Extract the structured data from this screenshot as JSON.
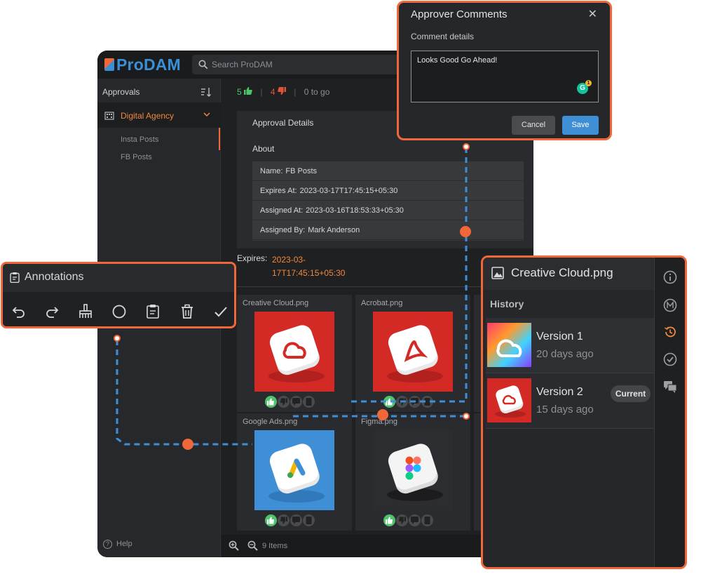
{
  "app": {
    "logo": "ProDAM",
    "search_placeholder": "Search ProDAM"
  },
  "sidebar": {
    "heading": "Approvals",
    "agency": "Digital Agency",
    "items": [
      {
        "label": "Insta Posts"
      },
      {
        "label": "FB Posts"
      }
    ],
    "help": "Help"
  },
  "votes": {
    "up": "5",
    "down": "4",
    "to_go": "0 to go"
  },
  "details": {
    "title": "Approval Details",
    "about": "About",
    "rows": [
      {
        "key": "Name:",
        "value": "FB Posts"
      },
      {
        "key": "Expires At:",
        "value": "2023-03-17T17:45:15+05:30"
      },
      {
        "key": "Assigned At:",
        "value": "2023-03-16T18:53:33+05:30"
      },
      {
        "key": "Assigned By:",
        "value": "Mark Anderson"
      }
    ],
    "expires_label": "Expires:",
    "expires_value": "2023-03-17T17:45:15+05:30"
  },
  "assets": [
    {
      "name": "Creative Cloud.png"
    },
    {
      "name": "Acrobat.png"
    },
    {
      "name": "Google Ads.png"
    },
    {
      "name": "Figma.png"
    }
  ],
  "footer": {
    "count": "9 Items"
  },
  "modal": {
    "title": "Approver Comments",
    "subtitle": "Comment details",
    "comment": "Looks Good Go Ahead!",
    "cancel": "Cancel",
    "save": "Save"
  },
  "annotations": {
    "title": "Annotations",
    "tools": [
      "undo-icon",
      "redo-icon",
      "brush-icon",
      "circle-icon",
      "note-icon",
      "trash-icon",
      "check-icon"
    ]
  },
  "panel": {
    "title": "Creative Cloud.png",
    "history": "History",
    "versions": [
      {
        "name": "Version 1",
        "age": "20 days ago"
      },
      {
        "name": "Version 2",
        "age": "15 days ago",
        "badge": "Current"
      }
    ]
  },
  "colors": {
    "accent": "#f0683a",
    "approve": "#4fc36b",
    "reject": "#e0543a",
    "primary": "#3f8fd6",
    "connector": "#3f8fd6"
  }
}
